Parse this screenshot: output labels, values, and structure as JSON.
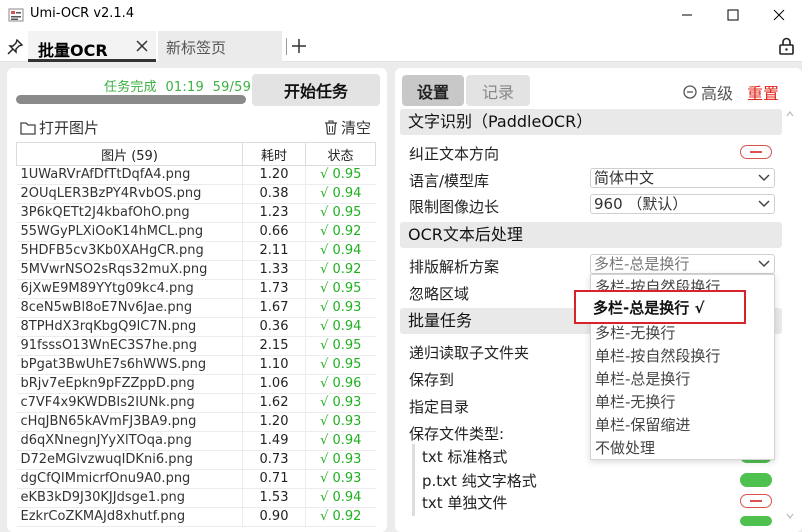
{
  "window": {
    "title": "Umi-OCR v2.1.4"
  },
  "tabs": {
    "active_label": "批量OCR",
    "new_tab_label": "新标签页"
  },
  "left": {
    "task_status": "任务完成  01:19  59/59",
    "progress_fraction": 1.0,
    "start_button": "开始任务",
    "open_images": "打开图片",
    "clear": "清空",
    "table": {
      "headers": [
        "图片 (59)",
        "耗时",
        "状态"
      ],
      "rows": [
        [
          "1UWaRVrAfDfTtDqfA4.png",
          "1.20",
          "√ 0.95"
        ],
        [
          "2OUqLER3BzPY4RvbOS.png",
          "0.38",
          "√ 0.94"
        ],
        [
          "3P6kQETt2J4kbafOhO.png",
          "1.23",
          "√ 0.95"
        ],
        [
          "55WGyPLXiOoK14hMCL.png",
          "0.66",
          "√ 0.92"
        ],
        [
          "5HDFB5cv3Kb0XAHgCR.png",
          "2.11",
          "√ 0.94"
        ],
        [
          "5MVwrNSO2sRqs32muX.png",
          "1.33",
          "√ 0.92"
        ],
        [
          "6jXwE9M89YYtg09kc4.png",
          "1.73",
          "√ 0.95"
        ],
        [
          "8ceN5wBl8oE7Nv6Jae.png",
          "1.67",
          "√ 0.93"
        ],
        [
          "8TPHdX3rqKbgQ9lC7N.png",
          "0.36",
          "√ 0.94"
        ],
        [
          "91fsssO13WnEC3S7he.png",
          "2.15",
          "√ 0.95"
        ],
        [
          "bPgat3BwUhE7s6hWWS.png",
          "1.10",
          "√ 0.95"
        ],
        [
          "bRjv7eEpkn9pFZZppD.png",
          "1.06",
          "√ 0.96"
        ],
        [
          "c7VF4x9KWDBIs2IUNk.png",
          "1.62",
          "√ 0.93"
        ],
        [
          "cHqJBN65kAVmFJ3BA9.png",
          "1.20",
          "√ 0.93"
        ],
        [
          "d6qXNnegnJYyXlTOqa.png",
          "1.49",
          "√ 0.94"
        ],
        [
          "D72eMGlvzwuqIDKni6.png",
          "0.73",
          "√ 0.93"
        ],
        [
          "dgCfQIMmicrfOnu9A0.png",
          "0.71",
          "√ 0.93"
        ],
        [
          "eKB3kD9J30KJJdsge1.png",
          "1.53",
          "√ 0.94"
        ],
        [
          "EzkrCoZKMAJd8xhutf.png",
          "0.90",
          "√ 0.92"
        ]
      ]
    }
  },
  "right": {
    "tab_settings": "设置",
    "tab_records": "记录",
    "advanced": "高级",
    "reset": "重置",
    "sec_text_recog": "文字识别（PaddleOCR）",
    "correct_direction": "纠正文本方向",
    "language_label": "语言/模型库",
    "language_value": "简体中文",
    "limit_label": "限制图像边长",
    "limit_value": "960 （默认）",
    "sec_post": "OCR文本后处理",
    "layout_label": "排版解析方案",
    "layout_value": "多栏-总是换行",
    "ignore_region": "忽略区域",
    "sec_batch": "批量任务",
    "recursive": "递归读取子文件夹",
    "save_to": "保存到",
    "specify_dir": "指定目录",
    "save_types": "保存文件类型:",
    "type_txt": "txt 标准格式",
    "type_ptxt": "p.txt 纯文字格式",
    "type_single": "txt 单独文件",
    "dropdown_options": [
      "多栏-按自然段换行",
      "多栏-无换行",
      "单栏-按自然段换行",
      "单栏-总是换行",
      "单栏-无换行",
      "单栏-保留缩进",
      "不做处理"
    ],
    "dropdown_selected": "多栏-总是换行 √",
    "colors": {
      "reset": "#e0261b",
      "success": "#20b020",
      "toggle_on": "#4fc14f",
      "toggle_off": "#d9534f",
      "highlight": "#d8232a"
    }
  }
}
